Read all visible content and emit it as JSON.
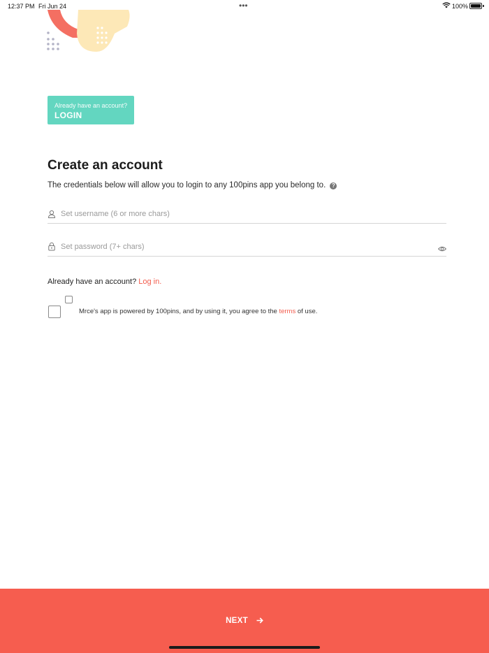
{
  "status_bar": {
    "time": "12:37 PM",
    "date": "Fri Jun 24",
    "battery": "100%"
  },
  "login_tile": {
    "prompt": "Already have an account?",
    "label": "LOGIN",
    "color": "#63d6c0"
  },
  "title": "Create an account",
  "subtitle": "The credentials below will allow you to login to any 100pins app you belong to.",
  "help_icon": "question-circle-icon",
  "username": {
    "placeholder": "Set username (6 or more chars)",
    "value": "",
    "icon": "user-icon"
  },
  "password": {
    "placeholder": "Set password (7+ chars)",
    "value": "",
    "icon": "lock-icon",
    "toggle_icon": "eye-icon"
  },
  "already": {
    "text": "Already have an account?",
    "link": "Log in."
  },
  "terms": {
    "text_before": "Mrce's app is powered by 100pins, and by using it, you agree to the ",
    "link": "terms",
    "text_after": " of use."
  },
  "next_button": {
    "label": "NEXT",
    "icon": "arrow-right-icon",
    "color": "#f65d4f"
  },
  "colors": {
    "accent": "#f25b4c",
    "teal": "#63d6c0",
    "decoration_yellow": "#fde8b7",
    "decoration_coral": "#f46f62"
  }
}
